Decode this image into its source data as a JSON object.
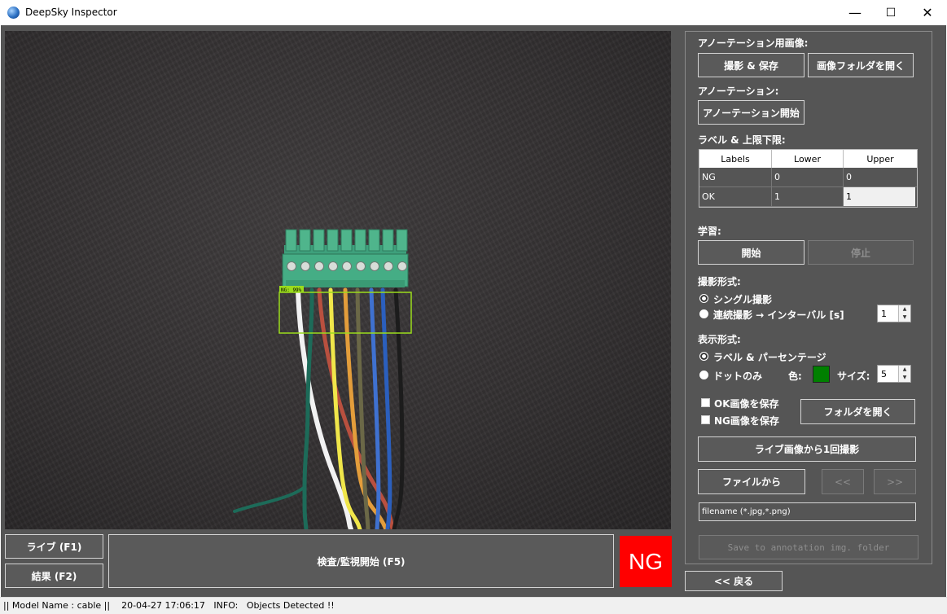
{
  "window": {
    "title": "DeepSky Inspector",
    "minimize": "—",
    "maximize": "☐",
    "close": "✕"
  },
  "camera": {
    "detection_label": "NG: 99%"
  },
  "bottom": {
    "live_button": "ライブ (F1)",
    "result_button": "結果 (F2)",
    "inspect_button": "検査/監視開始 (F5)",
    "result_indicator": "NG",
    "back_button": "<< 戻る"
  },
  "panel": {
    "annotation_image_heading": "アノーテーション用画像:",
    "capture_save_button": "撮影 & 保存",
    "open_image_folder_button": "画像フォルダを開く",
    "annotation_heading": "アノーテーション:",
    "start_annotation_button": "アノーテーション開始",
    "labels_heading": "ラベル & 上限下限:",
    "table": {
      "headers": [
        "Labels",
        "Lower",
        "Upper"
      ],
      "rows": [
        [
          "NG",
          "0",
          "0"
        ],
        [
          "OK",
          "1",
          "1"
        ]
      ]
    },
    "training_heading": "学習:",
    "train_start_button": "開始",
    "train_stop_button": "停止",
    "capture_mode_heading": "撮影形式:",
    "single_capture": "シングル撮影",
    "continuous_capture": "連続撮影 → インターバル [s]",
    "interval_value": "1",
    "display_mode_heading": "表示形式:",
    "label_percentage": "ラベル & パーセンテージ",
    "dot_only": "ドットのみ",
    "color_label": "色:",
    "size_label": "サイズ:",
    "size_value": "5",
    "dot_color": "#008000",
    "save_ok_images": "OK画像を保存",
    "save_ng_images": "NG画像を保存",
    "open_folder_button": "フォルダを開く",
    "capture_once_from_live_button": "ライブ画像から1回撮影",
    "from_file_button": "ファイルから",
    "prev_button": "<<",
    "next_button": ">>",
    "filename_placeholder": "filename (*.jpg,*.png)",
    "save_to_annotation_button": "Save to annotation img. folder"
  },
  "status": {
    "text": "|| Model Name : cable ||    20-04-27 17:06:17   INFO:   Objects Detected !!"
  }
}
